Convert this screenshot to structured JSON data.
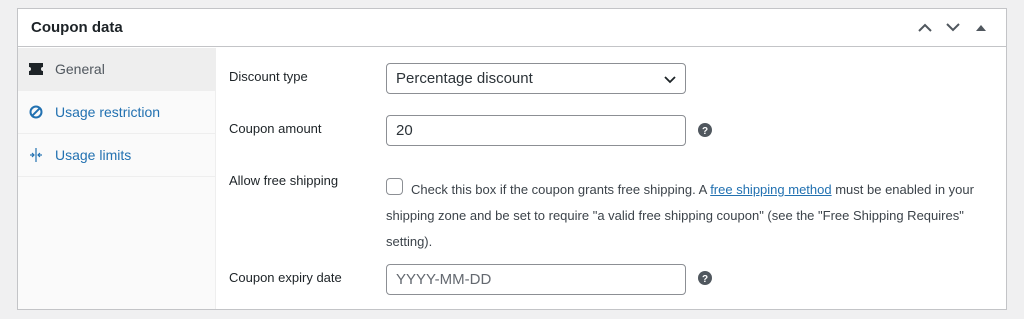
{
  "metabox": {
    "title": "Coupon data",
    "actions": [
      "move-up-icon",
      "move-down-icon",
      "toggle-panel-icon"
    ]
  },
  "tabs": [
    {
      "label": "General",
      "icon": "ticket-icon",
      "active": true
    },
    {
      "label": "Usage restriction",
      "icon": "block-icon",
      "active": false
    },
    {
      "label": "Usage limits",
      "icon": "limits-icon",
      "active": false
    }
  ],
  "fields": {
    "discount_type": {
      "label": "Discount type",
      "value": "Percentage discount"
    },
    "coupon_amount": {
      "label": "Coupon amount",
      "value": "20"
    },
    "free_shipping": {
      "label": "Allow free shipping",
      "checked": false,
      "text_before": "Check this box if the coupon grants free shipping. A ",
      "link_text": "free shipping method",
      "text_after": " must be enabled in your shipping zone and be set to require \"a valid free shipping coupon\" (see the \"Free Shipping Requires\" setting)."
    },
    "expiry_date": {
      "label": "Coupon expiry date",
      "placeholder": "YYYY-MM-DD",
      "value": ""
    }
  },
  "colors": {
    "link": "#2271b1",
    "border": "#c3c4c7",
    "help_icon": "#50575e"
  }
}
